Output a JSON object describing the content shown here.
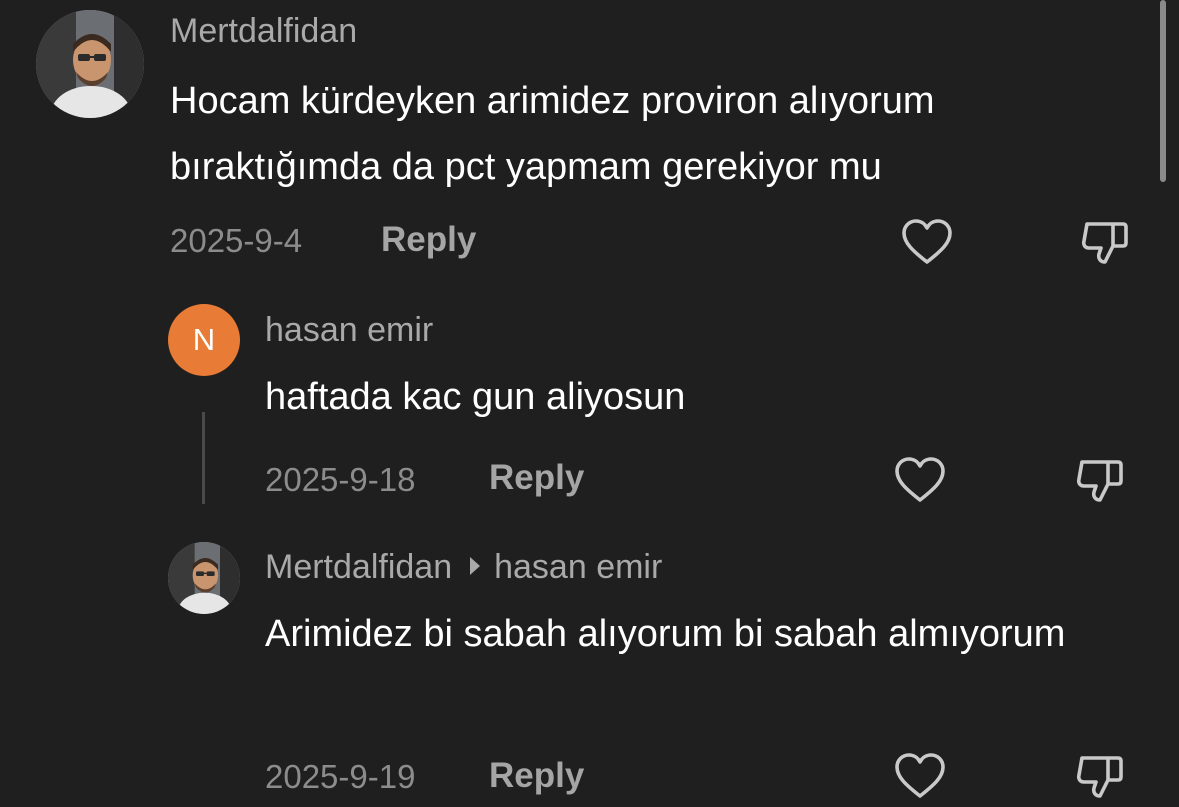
{
  "comments": [
    {
      "username": "Mertdalfidan",
      "text": "Hocam kürdeyken arimidez proviron alıyorum bıraktığımda da pct yapmam gerekiyor mu",
      "date": "2025-9-4",
      "reply_label": "Reply"
    },
    {
      "avatar_letter": "N",
      "avatar_color": "#e87b35",
      "username": "hasan emir",
      "text": "haftada kac gun aliyosun",
      "date": "2025-9-18",
      "reply_label": "Reply"
    },
    {
      "username": "Mertdalfidan",
      "reply_to": "hasan emir",
      "text": "Arimidez bi sabah alıyorum bi sabah almıyorum",
      "date": "2025-9-19",
      "reply_label": "Reply"
    }
  ],
  "icons": {
    "like": "heart-outline-icon",
    "dislike": "thumbs-down-outline-icon",
    "reply_to_separator": "caret-right-icon"
  },
  "colors": {
    "background": "#1f1f1f",
    "text": "#ffffff",
    "username": "#a9a9a9",
    "meta": "#8c8c8c"
  }
}
